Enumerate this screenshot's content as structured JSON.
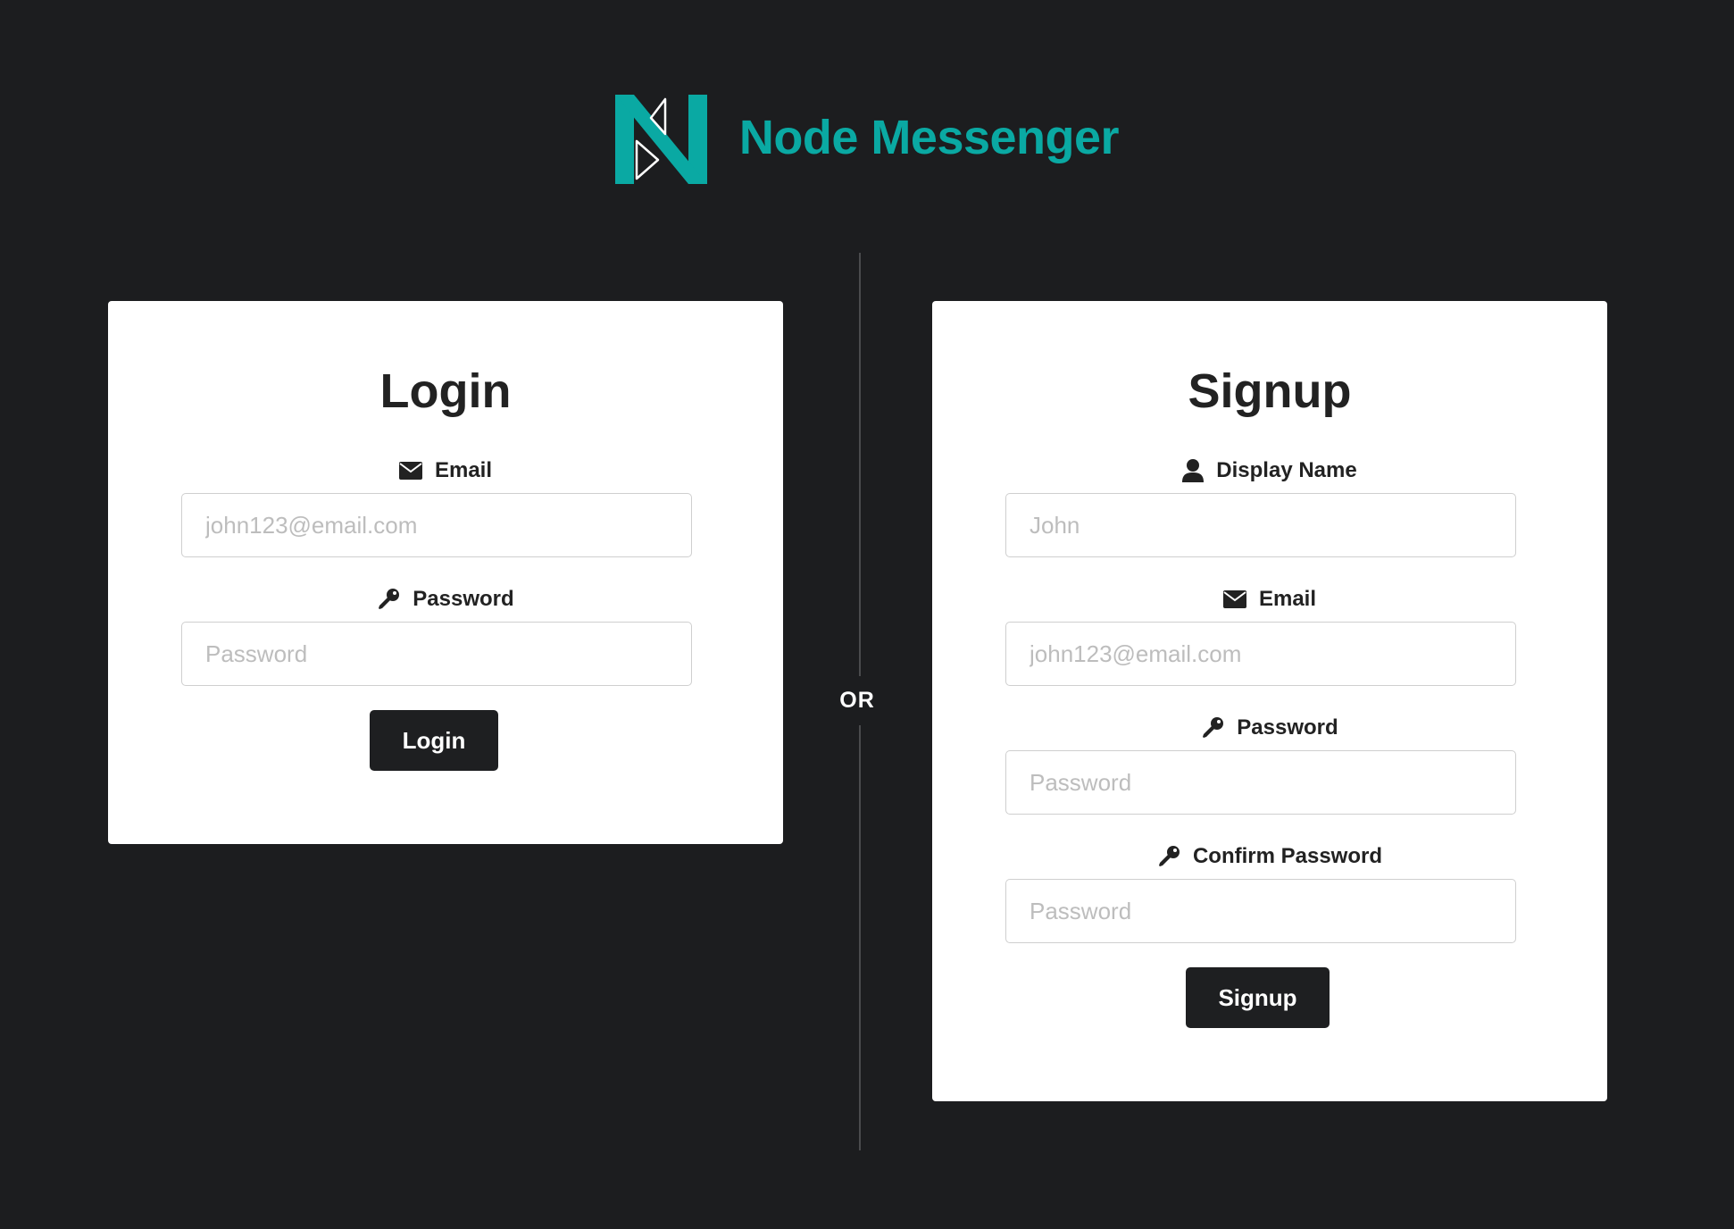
{
  "header": {
    "brand_name": "Node Messenger",
    "logo_icon": "node-messenger-logo",
    "brand_color": "#0aa9a3"
  },
  "login": {
    "title": "Login",
    "email_label": "Email",
    "email_placeholder": "john123@email.com",
    "email_icon": "envelope-icon",
    "password_label": "Password",
    "password_placeholder": "Password",
    "password_icon": "key-icon",
    "button_label": "Login"
  },
  "divider": {
    "text": "OR"
  },
  "signup": {
    "title": "Signup",
    "display_name_label": "Display Name",
    "display_name_placeholder": "John",
    "display_name_icon": "user-icon",
    "email_label": "Email",
    "email_placeholder": "john123@email.com",
    "email_icon": "envelope-icon",
    "password_label": "Password",
    "password_placeholder": "Password",
    "password_icon": "key-icon",
    "confirm_password_label": "Confirm Password",
    "confirm_password_placeholder": "Password",
    "confirm_password_icon": "key-icon",
    "button_label": "Signup"
  },
  "colors": {
    "background": "#1c1d1f",
    "card": "#ffffff",
    "button": "#1e1f21"
  }
}
